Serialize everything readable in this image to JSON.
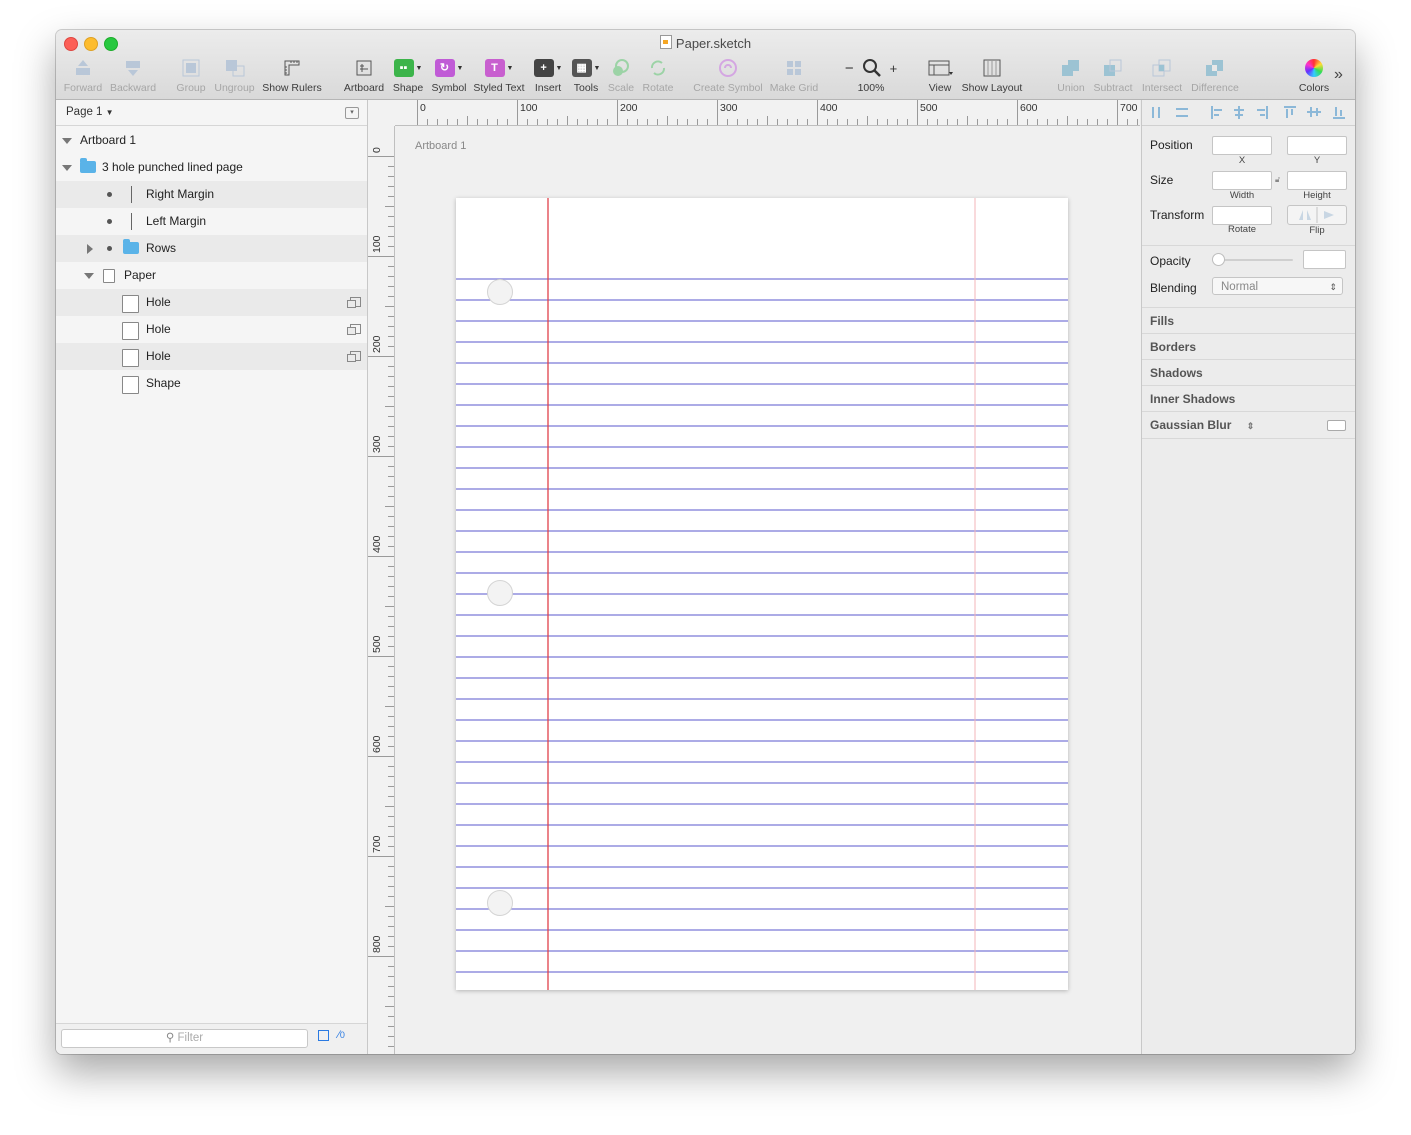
{
  "window": {
    "title": "Paper.sketch"
  },
  "toolbar": [
    {
      "id": "forward",
      "label": "Forward",
      "disabled": true
    },
    {
      "id": "backward",
      "label": "Backward",
      "disabled": true
    },
    {
      "id": "group",
      "label": "Group",
      "disabled": true
    },
    {
      "id": "ungroup",
      "label": "Ungroup",
      "disabled": true
    },
    {
      "id": "show-rulers",
      "label": "Show Rulers",
      "disabled": false
    },
    {
      "id": "artboard",
      "label": "Artboard",
      "disabled": false
    },
    {
      "id": "shape",
      "label": "Shape",
      "disabled": false
    },
    {
      "id": "symbol",
      "label": "Symbol",
      "disabled": false
    },
    {
      "id": "styled-text",
      "label": "Styled Text",
      "disabled": false
    },
    {
      "id": "insert",
      "label": "Insert",
      "disabled": false
    },
    {
      "id": "tools",
      "label": "Tools",
      "disabled": false
    },
    {
      "id": "scale",
      "label": "Scale",
      "disabled": true
    },
    {
      "id": "rotate",
      "label": "Rotate",
      "disabled": true
    },
    {
      "id": "create-symbol",
      "label": "Create Symbol",
      "disabled": true
    },
    {
      "id": "make-grid",
      "label": "Make Grid",
      "disabled": true
    },
    {
      "id": "zoom",
      "label": "100%",
      "disabled": false
    },
    {
      "id": "view",
      "label": "View",
      "disabled": false
    },
    {
      "id": "show-layout",
      "label": "Show Layout",
      "disabled": false
    },
    {
      "id": "union",
      "label": "Union",
      "disabled": true
    },
    {
      "id": "subtract",
      "label": "Subtract",
      "disabled": true
    },
    {
      "id": "intersect",
      "label": "Intersect",
      "disabled": true
    },
    {
      "id": "difference",
      "label": "Difference",
      "disabled": true
    },
    {
      "id": "colors",
      "label": "Colors",
      "disabled": false
    }
  ],
  "zoom_minus": "−",
  "zoom_plus": "+",
  "overflow_chevron": "»",
  "layers": {
    "page": "Page 1",
    "items": [
      {
        "name": "Artboard 1",
        "type": "artboard"
      },
      {
        "name": "3 hole punched lined page",
        "type": "group"
      },
      {
        "name": "Right Margin",
        "type": "line"
      },
      {
        "name": "Left Margin",
        "type": "line"
      },
      {
        "name": "Rows",
        "type": "group"
      },
      {
        "name": "Paper",
        "type": "group"
      },
      {
        "name": "Hole",
        "type": "symbol"
      },
      {
        "name": "Hole",
        "type": "symbol"
      },
      {
        "name": "Hole",
        "type": "symbol"
      },
      {
        "name": "Shape",
        "type": "shape"
      }
    ],
    "filter_placeholder": "Filter",
    "slice_count": "0"
  },
  "rulers": {
    "h_labels": [
      "0",
      "100",
      "200",
      "300",
      "400",
      "500",
      "600",
      "700"
    ],
    "v_labels": [
      "0",
      "100",
      "200",
      "300",
      "400",
      "500",
      "600",
      "700",
      "800"
    ]
  },
  "canvas": {
    "artboard_label": "Artboard 1"
  },
  "inspector": {
    "position_label": "Position",
    "x_label": "X",
    "y_label": "Y",
    "size_label": "Size",
    "width_label": "Width",
    "height_label": "Height",
    "transform_label": "Transform",
    "rotate_label": "Rotate",
    "flip_label": "Flip",
    "opacity_label": "Opacity",
    "blending_label": "Blending",
    "blending_value": "Normal",
    "sections": [
      "Fills",
      "Borders",
      "Shadows",
      "Inner Shadows",
      "Gaussian Blur"
    ]
  },
  "colors": {
    "rule_line": "#7b79d8",
    "left_margin": "#e0414a",
    "right_margin": "#f3b4b8"
  }
}
